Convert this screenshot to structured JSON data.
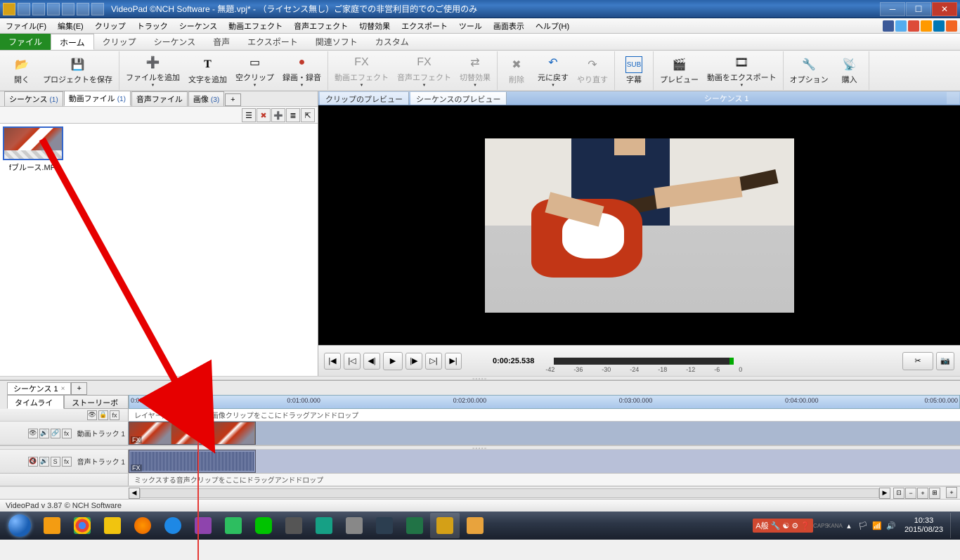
{
  "titlebar": {
    "title": "VideoPad ©NCH Software - 無題.vpj* - （ライセンス無し）ご家庭での非営利目的でのご使用のみ"
  },
  "menubar": {
    "items": [
      "ファイル(F)",
      "編集(E)",
      "クリップ",
      "トラック",
      "シーケンス",
      "動画エフェクト",
      "音声エフェクト",
      "切替効果",
      "エクスポート",
      "ツール",
      "画面表示",
      "ヘルプ(H)"
    ]
  },
  "ribtabs": {
    "file": "ファイル",
    "tabs": [
      "ホーム",
      "クリップ",
      "シーケンス",
      "音声",
      "エクスポート",
      "関連ソフト",
      "カスタム"
    ]
  },
  "ribbon": {
    "open": "開く",
    "save": "プロジェクトを保存",
    "addfile": "ファイルを追加",
    "addtext": "文字を追加",
    "blank": "空クリップ",
    "record": "録画・録音",
    "vfx": "動画エフェクト",
    "afx": "音声エフェクト",
    "trans": "切替効果",
    "delete": "削除",
    "undo": "元に戻す",
    "redo": "やり直す",
    "sub": "字幕",
    "preview": "プレビュー",
    "export": "動画をエクスポート",
    "options": "オプション",
    "buy": "購入"
  },
  "bintabs": {
    "seq": "シーケンス",
    "seq_cnt": "(1)",
    "vid": "動画ファイル",
    "vid_cnt": "(1)",
    "aud": "音声ファイル",
    "img": "画像",
    "img_cnt": "(3)"
  },
  "clip": {
    "name": "fブルース.MP4"
  },
  "prevtabs": {
    "clip": "クリップのプレビュー",
    "seq": "シーケンスのプレビュー",
    "seqname": "シーケンス 1"
  },
  "preview": {
    "timecode": "0:00:25.538",
    "meter_labels": [
      "-42",
      "-36",
      "-30",
      "-24",
      "-18",
      "-12",
      "-6",
      "0"
    ]
  },
  "seqtab": {
    "name": "シーケンス 1"
  },
  "viewtabs": {
    "tl": "タイムライン",
    "sb": "ストーリーボー"
  },
  "ruler": [
    "0:00:00.000",
    "0:01:00.000",
    "0:02:00.000",
    "0:03:00.000",
    "0:04:00.000",
    "0:05:00.000"
  ],
  "tracks": {
    "overlay_hint": "レイヤー用動画、文字、画像クリップをここにドラッグアンドドロップ",
    "vid": "動画トラック 1",
    "aud": "音声トラック 1",
    "mix_hint": "ミックスする音声クリップをここにドラッグアンドドロップ",
    "fx": "FX"
  },
  "status": {
    "text": "VideoPad v 3.87  © NCH Software"
  },
  "tray": {
    "ime": "A般",
    "caps": "CAPS",
    "kana": "KANA",
    "time": "10:33",
    "date": "2015/08/23"
  }
}
